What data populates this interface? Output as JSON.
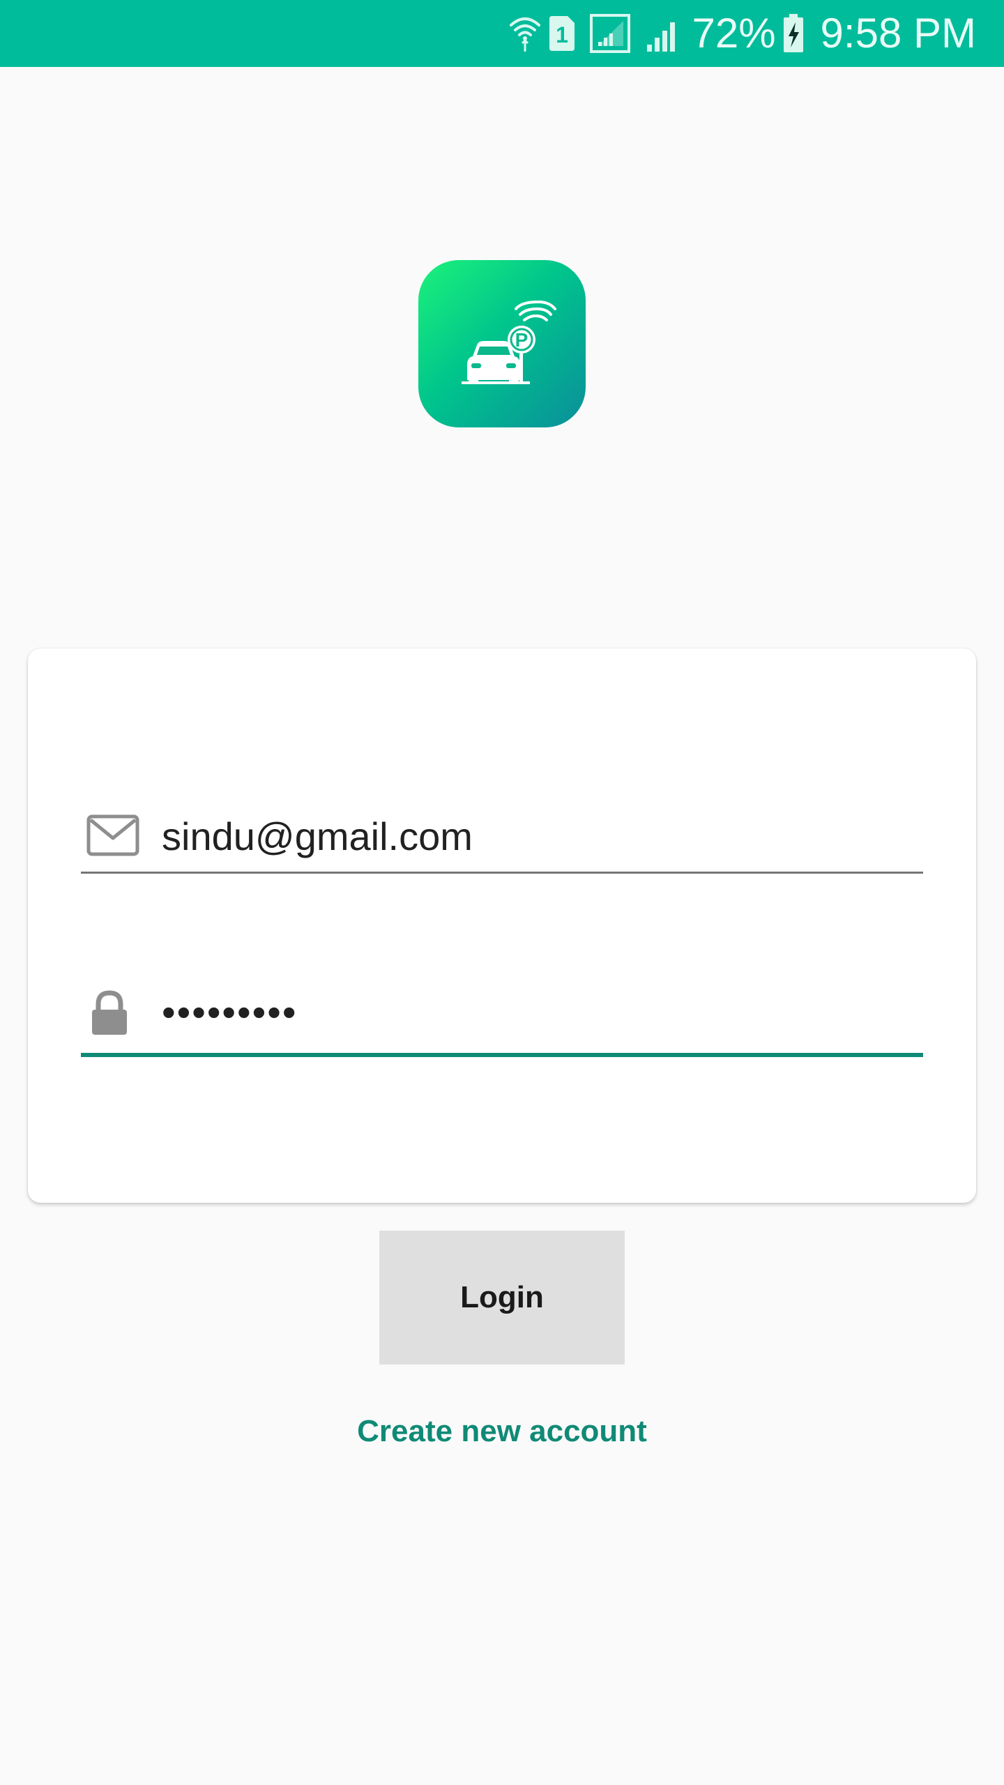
{
  "status_bar": {
    "background": "#00bc9b",
    "icons": [
      "wifi-icon",
      "sim-1-icon",
      "signal-sim1-icon",
      "signal-sim2-icon",
      "battery-charging-icon"
    ],
    "sim_label": "1",
    "battery_percent": "72%",
    "time": "9:58 PM"
  },
  "logo": {
    "icon": "car-parking-wifi-icon",
    "letter": "P"
  },
  "login_form": {
    "email": {
      "icon": "mail-icon",
      "value": "sindu@gmail.com"
    },
    "password": {
      "icon": "lock-icon",
      "value": "•••••••••"
    }
  },
  "actions": {
    "login_label": "Login",
    "create_account_label": "Create new account"
  },
  "colors": {
    "accent": "#0f8a76",
    "status_bar": "#00bc9b",
    "button_bg": "#dfdfdf"
  }
}
